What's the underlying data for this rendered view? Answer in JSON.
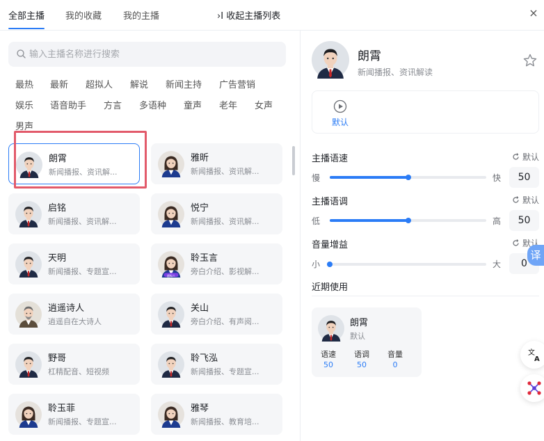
{
  "tabs": [
    {
      "label": "全部主播",
      "active": true
    },
    {
      "label": "我的收藏",
      "active": false
    },
    {
      "label": "我的主播",
      "active": false
    }
  ],
  "collapse_label": "收起主播列表",
  "collapse_prefix": "›I",
  "close_symbol": "×",
  "search": {
    "placeholder": "输入主播名称进行搜索",
    "value": ""
  },
  "categories": [
    "最热",
    "最新",
    "超拟人",
    "解说",
    "新闻主持",
    "广告营销",
    "娱乐",
    "语音助手",
    "方言",
    "多语种",
    "童声",
    "老年",
    "女声",
    "男声"
  ],
  "anchors": [
    {
      "name": "朗霄",
      "desc": "新闻播报、资讯解...",
      "gender": "male",
      "selected": true
    },
    {
      "name": "雅昕",
      "desc": "新闻播报、资讯解...",
      "gender": "female",
      "selected": false
    },
    {
      "name": "启铭",
      "desc": "新闻播报、资讯解...",
      "gender": "male",
      "selected": false
    },
    {
      "name": "悦宁",
      "desc": "新闻播报、资讯解...",
      "gender": "female",
      "selected": false
    },
    {
      "name": "天明",
      "desc": "新闻播报、专题宣...",
      "gender": "male",
      "selected": false
    },
    {
      "name": "聆玉言",
      "desc": "旁白介绍、影视解...",
      "gender": "female",
      "selected": false,
      "badge": "超拟人"
    },
    {
      "name": "逍遥诗人",
      "desc": "逍遥自在大诗人",
      "gender": "elder",
      "selected": false
    },
    {
      "name": "关山",
      "desc": "旁白介绍、有声阅...",
      "gender": "male",
      "selected": false
    },
    {
      "name": "野哥",
      "desc": "杠精配音、短视频",
      "gender": "male",
      "selected": false
    },
    {
      "name": "聆飞泓",
      "desc": "新闻播报、专题宣...",
      "gender": "male",
      "selected": false
    },
    {
      "name": "聆玉菲",
      "desc": "新闻播报、专题宣...",
      "gender": "female",
      "selected": false
    },
    {
      "name": "雅琴",
      "desc": "新闻播报、教育培...",
      "gender": "female",
      "selected": false
    }
  ],
  "detail": {
    "name": "朗霄",
    "desc": "新闻播报、资讯解读",
    "style_label": "默认",
    "controls": [
      {
        "title": "主播语速",
        "reset": "默认",
        "min_label": "慢",
        "max_label": "快",
        "value": "50",
        "fraction": 0.5
      },
      {
        "title": "主播语调",
        "reset": "默认",
        "min_label": "低",
        "max_label": "高",
        "value": "50",
        "fraction": 0.5
      },
      {
        "title": "音量增益",
        "reset": "默认",
        "min_label": "小",
        "max_label": "大",
        "value": "0",
        "fraction": 0.0
      }
    ]
  },
  "translate_float": "译",
  "recent": {
    "title": "近期使用",
    "name": "朗霄",
    "style": "默认",
    "stats": [
      {
        "label": "语速",
        "value": "50"
      },
      {
        "label": "语调",
        "value": "50"
      },
      {
        "label": "音量",
        "value": "0"
      }
    ]
  },
  "colors": {
    "accent": "#2b7cf6",
    "highlight": "#e25a6a"
  }
}
